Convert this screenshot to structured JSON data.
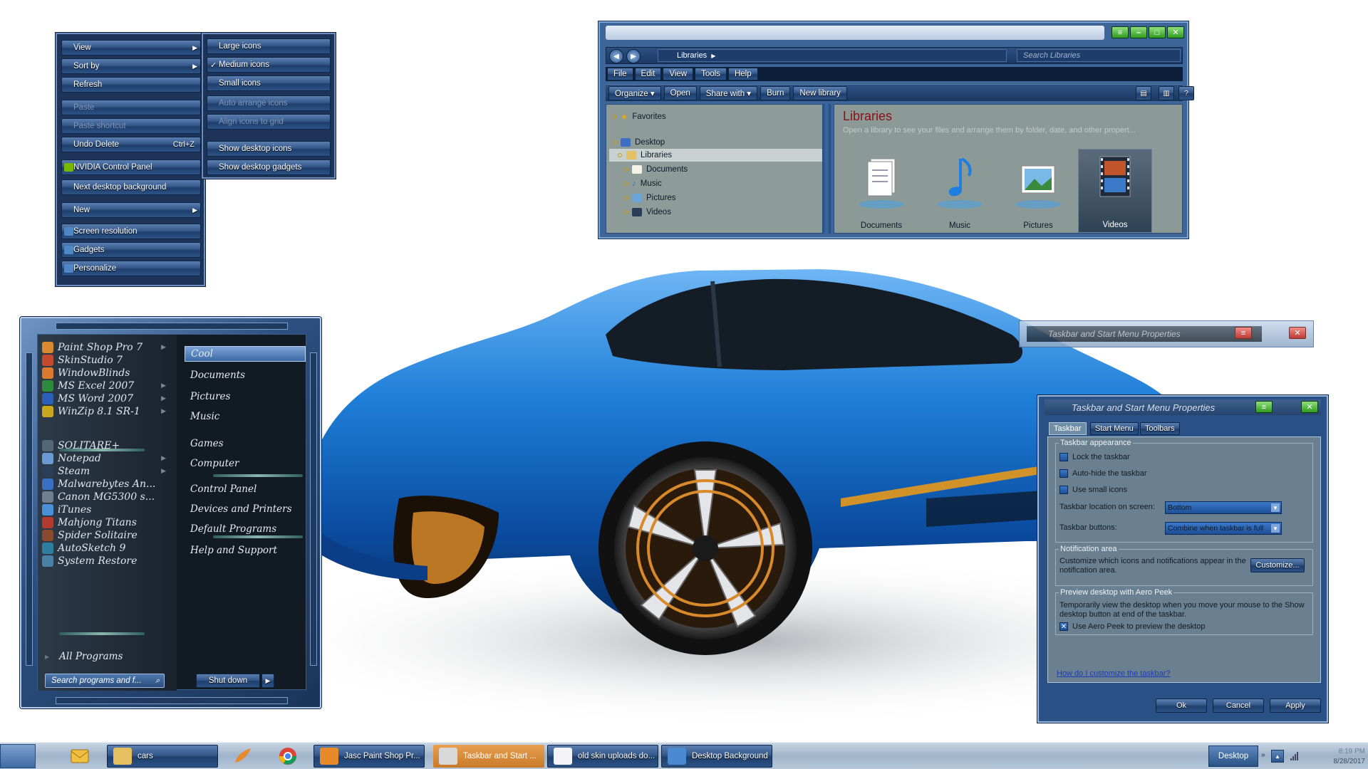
{
  "context_menu": {
    "items": [
      {
        "label": "View",
        "arrow": true,
        "disabled": false
      },
      {
        "label": "Sort by",
        "arrow": true,
        "disabled": false
      },
      {
        "label": "Refresh",
        "disabled": false
      },
      {
        "label": "Paste",
        "disabled": true
      },
      {
        "label": "Paste shortcut",
        "disabled": true
      },
      {
        "label": "Undo Delete",
        "accel": "Ctrl+Z",
        "disabled": false
      },
      {
        "label": "NVIDIA Control Panel",
        "icon": "nvidia-icon",
        "disabled": false
      },
      {
        "label": "Next desktop background",
        "disabled": false
      },
      {
        "label": "New",
        "arrow": true,
        "disabled": false
      },
      {
        "label": "Screen resolution",
        "icon": "display-icon",
        "disabled": false
      },
      {
        "label": "Gadgets",
        "icon": "gadgets-icon",
        "disabled": false
      },
      {
        "label": "Personalize",
        "icon": "personalize-icon",
        "disabled": false
      }
    ],
    "view_submenu": [
      {
        "label": "Large icons",
        "checked": false,
        "disabled": false
      },
      {
        "label": "Medium icons",
        "checked": true,
        "disabled": false
      },
      {
        "label": "Small icons",
        "checked": false,
        "disabled": false
      },
      {
        "label": "Auto arrange icons",
        "checked": false,
        "disabled": true
      },
      {
        "label": "Align icons to grid",
        "checked": false,
        "disabled": true
      },
      {
        "label": "Show desktop icons",
        "checked": false,
        "disabled": false
      },
      {
        "label": "Show desktop gadgets",
        "checked": false,
        "disabled": false
      }
    ],
    "check_glyph": "✓"
  },
  "explorer": {
    "address": "Libraries",
    "search_placeholder": "Search Libraries",
    "menu": [
      "File",
      "Edit",
      "View",
      "Tools",
      "Help"
    ],
    "toolbar": [
      "Organize ▾",
      "Open",
      "Share with ▾",
      "Burn",
      "New library"
    ],
    "nav": {
      "favorites": "Favorites",
      "desktop": "Desktop",
      "libraries": "Libraries",
      "documents": "Documents",
      "music": "Music",
      "pictures": "Pictures",
      "videos": "Videos"
    },
    "content": {
      "title": "Libraries",
      "description": "Open a library to see your files and arrange them by folder, date, and other propert...",
      "tiles": [
        "Documents",
        "Music",
        "Pictures",
        "Videos"
      ]
    }
  },
  "start_menu": {
    "programs": [
      {
        "label": "Paint Shop Pro 7",
        "arrow": true,
        "color": "#d98a2e"
      },
      {
        "label": "SkinStudio 7",
        "color": "#c24a2e"
      },
      {
        "label": "WindowBlinds",
        "color": "#d97a2e"
      },
      {
        "label": "MS Excel 2007",
        "arrow": true,
        "color": "#2e8b3e"
      },
      {
        "label": "MS Word 2007",
        "arrow": true,
        "color": "#2e5fb8"
      },
      {
        "label": "WinZip 8.1 SR-1",
        "arrow": true,
        "color": "#c8a61e"
      },
      {
        "label": "SOLITARE+",
        "color": "#556677"
      },
      {
        "label": "Notepad",
        "arrow": true,
        "color": "#6a9ad0"
      },
      {
        "label": "Steam",
        "arrow": true,
        "color": "#2a3e5a"
      },
      {
        "label": "Malwarebytes An...",
        "color": "#3b6fc4"
      },
      {
        "label": "Canon MG5300 s...",
        "color": "#6f7f8f"
      },
      {
        "label": "iTunes",
        "color": "#4a90d9"
      },
      {
        "label": "Mahjong Titans",
        "color": "#b23a2e"
      },
      {
        "label": "Spider Solitaire",
        "color": "#8a4a2e"
      },
      {
        "label": "AutoSketch 9",
        "color": "#2e7f9f"
      },
      {
        "label": "System Restore",
        "color": "#4a7fa8"
      }
    ],
    "all_programs": "All Programs",
    "places": [
      "Cool",
      "Documents",
      "Pictures",
      "Music",
      "Games",
      "Computer",
      "Control Panel",
      "Devices and Printers",
      "Default Programs",
      "Help and Support"
    ],
    "search_placeholder": "Search programs and f...",
    "shutdown": "Shut down"
  },
  "taskbar_dialog": {
    "ghost_title": "Taskbar and Start Menu Properties",
    "title": "Taskbar and Start Menu Properties",
    "tabs": [
      "Taskbar",
      "Start Menu",
      "Toolbars"
    ],
    "appearance_group": "Taskbar appearance",
    "lock": "Lock the taskbar",
    "autohide": "Auto-hide the taskbar",
    "small_icons": "Use small icons",
    "location_label": "Taskbar location on screen:",
    "location_value": "Bottom",
    "buttons_label": "Taskbar buttons:",
    "buttons_value": "Combine when taskbar is full",
    "notify_group": "Notification area",
    "notify_text": "Customize which icons and notifications appear in the notification area.",
    "customize": "Customize...",
    "peek_group": "Preview desktop with Aero Peek",
    "peek_text": "Temporarily view the desktop when you move your mouse to the Show desktop button at end of the taskbar.",
    "peek_check": "Use Aero Peek to preview the desktop",
    "help_link": "How do I customize the taskbar?",
    "ok": "Ok",
    "cancel": "Cancel",
    "apply": "Apply"
  },
  "taskbar": {
    "folder_label": "cars",
    "buttons": [
      {
        "label": "Jasc Paint Shop Pr...",
        "active": false
      },
      {
        "label": "Taskbar and Start ...",
        "active": true
      },
      {
        "label": "old skin uploads do...",
        "active": false
      },
      {
        "label": "Desktop Background",
        "active": false
      }
    ],
    "desktop": "Desktop",
    "time": "8:19 PM",
    "date": "8/28/2017"
  },
  "colors": {
    "accent_blue": "#2b5386",
    "window_frame": "#7da3d6",
    "library_title": "#8b0f12",
    "taskbar_active": "#c87a2a"
  }
}
